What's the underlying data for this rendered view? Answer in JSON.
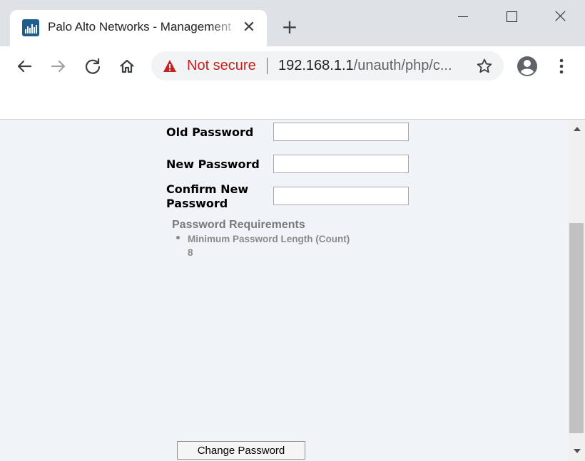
{
  "tab": {
    "title": "Palo Alto Networks - Management",
    "favicon": "palo-alto-networks-logo",
    "close_glyph": "✕"
  },
  "new_tab_glyph": "+",
  "window_controls": [
    "minimize-icon",
    "maximize-icon",
    "close-icon"
  ],
  "toolbar": {
    "back_icon": "back-arrow-icon",
    "forward_icon": "forward-arrow-icon",
    "reload_icon": "reload-icon",
    "home_icon": "home-icon",
    "security_label": "Not secure",
    "url_host": "192.168.1.1",
    "url_path": "/unauth/php/c...",
    "star_icon": "bookmark-star-icon",
    "account_icon": "account-icon",
    "menu_icon": "kebab-menu-icon"
  },
  "form": {
    "old_password_label": "Old Password",
    "new_password_label": "New Password",
    "confirm_password_label": "Confirm New Password",
    "old_password_value": "",
    "new_password_value": "",
    "confirm_password_value": ""
  },
  "requirements": {
    "title": "Password Requirements",
    "items": [
      {
        "label": "Minimum Password Length (Count)",
        "value": "8"
      }
    ]
  },
  "submit_label": "Change Password",
  "colors": {
    "page_background": "#f0f3f8",
    "warning": "#c5221f",
    "tab_strip": "#dee1e6"
  }
}
